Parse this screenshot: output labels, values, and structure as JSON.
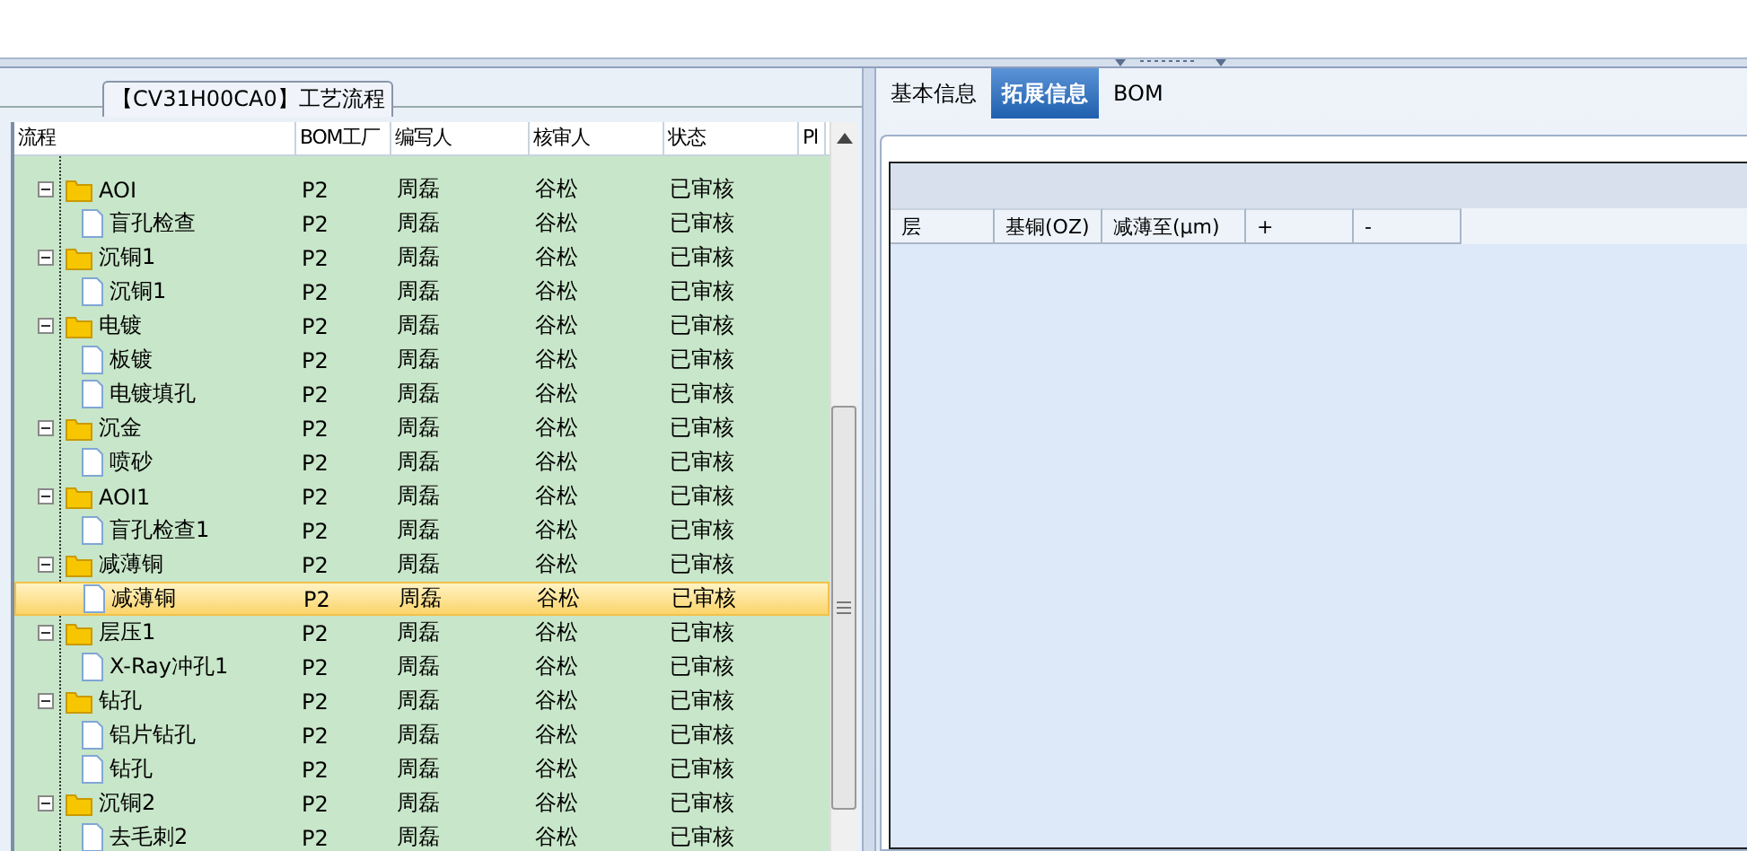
{
  "process_panel": {
    "title": "【CV31H00CA0】工艺流程",
    "columns": [
      "流程",
      "BOM工厂",
      "编写人",
      "核审人",
      "状态",
      "Pl"
    ],
    "rows": [
      {
        "kind": "folder",
        "name": "AOI",
        "bom": "P2",
        "writer": "周磊",
        "reviewer": "谷松",
        "status": "已审核",
        "expanded": true,
        "selected": false,
        "children": [
          {
            "kind": "step",
            "name": "盲孔检查",
            "bom": "P2",
            "writer": "周磊",
            "reviewer": "谷松",
            "status": "已审核",
            "selected": false
          }
        ]
      },
      {
        "kind": "folder",
        "name": "沉铜1",
        "bom": "P2",
        "writer": "周磊",
        "reviewer": "谷松",
        "status": "已审核",
        "expanded": true,
        "selected": false,
        "children": [
          {
            "kind": "step",
            "name": "沉铜1",
            "bom": "P2",
            "writer": "周磊",
            "reviewer": "谷松",
            "status": "已审核",
            "selected": false
          }
        ]
      },
      {
        "kind": "folder",
        "name": "电镀",
        "bom": "P2",
        "writer": "周磊",
        "reviewer": "谷松",
        "status": "已审核",
        "expanded": true,
        "selected": false,
        "children": [
          {
            "kind": "step",
            "name": "板镀",
            "bom": "P2",
            "writer": "周磊",
            "reviewer": "谷松",
            "status": "已审核",
            "selected": false
          },
          {
            "kind": "step",
            "name": "电镀填孔",
            "bom": "P2",
            "writer": "周磊",
            "reviewer": "谷松",
            "status": "已审核",
            "selected": false
          }
        ]
      },
      {
        "kind": "folder",
        "name": "沉金",
        "bom": "P2",
        "writer": "周磊",
        "reviewer": "谷松",
        "status": "已审核",
        "expanded": true,
        "selected": false,
        "children": [
          {
            "kind": "step",
            "name": "喷砂",
            "bom": "P2",
            "writer": "周磊",
            "reviewer": "谷松",
            "status": "已审核",
            "selected": false
          }
        ]
      },
      {
        "kind": "folder",
        "name": "AOI1",
        "bom": "P2",
        "writer": "周磊",
        "reviewer": "谷松",
        "status": "已审核",
        "expanded": true,
        "selected": false,
        "children": [
          {
            "kind": "step",
            "name": "盲孔检查1",
            "bom": "P2",
            "writer": "周磊",
            "reviewer": "谷松",
            "status": "已审核",
            "selected": false
          }
        ]
      },
      {
        "kind": "folder",
        "name": "减薄铜",
        "bom": "P2",
        "writer": "周磊",
        "reviewer": "谷松",
        "status": "已审核",
        "expanded": true,
        "selected": false,
        "children": [
          {
            "kind": "step",
            "name": "减薄铜",
            "bom": "P2",
            "writer": "周磊",
            "reviewer": "谷松",
            "status": "已审核",
            "selected": true
          }
        ]
      },
      {
        "kind": "folder",
        "name": "层压1",
        "bom": "P2",
        "writer": "周磊",
        "reviewer": "谷松",
        "status": "已审核",
        "expanded": true,
        "selected": false,
        "children": [
          {
            "kind": "step",
            "name": "X-Ray冲孔1",
            "bom": "P2",
            "writer": "周磊",
            "reviewer": "谷松",
            "status": "已审核",
            "selected": false
          }
        ]
      },
      {
        "kind": "folder",
        "name": "钻孔",
        "bom": "P2",
        "writer": "周磊",
        "reviewer": "谷松",
        "status": "已审核",
        "expanded": true,
        "selected": false,
        "children": [
          {
            "kind": "step",
            "name": "铝片钻孔",
            "bom": "P2",
            "writer": "周磊",
            "reviewer": "谷松",
            "status": "已审核",
            "selected": false
          },
          {
            "kind": "step",
            "name": "钻孔",
            "bom": "P2",
            "writer": "周磊",
            "reviewer": "谷松",
            "status": "已审核",
            "selected": false
          }
        ]
      },
      {
        "kind": "folder",
        "name": "沉铜2",
        "bom": "P2",
        "writer": "周磊",
        "reviewer": "谷松",
        "status": "已审核",
        "expanded": true,
        "selected": false,
        "children": [
          {
            "kind": "step",
            "name": "去毛刺2",
            "bom": "P2",
            "writer": "周磊",
            "reviewer": "谷松",
            "status": "已审核",
            "selected": false
          }
        ]
      }
    ]
  },
  "tabs": [
    {
      "label": "基本信息",
      "selected": false
    },
    {
      "label": "拓展信息",
      "selected": true
    },
    {
      "label": "BOM",
      "selected": false
    }
  ],
  "layer_table": {
    "columns": [
      "层",
      "基铜(OZ)",
      "减薄至(μm)",
      "+",
      "-"
    ]
  }
}
